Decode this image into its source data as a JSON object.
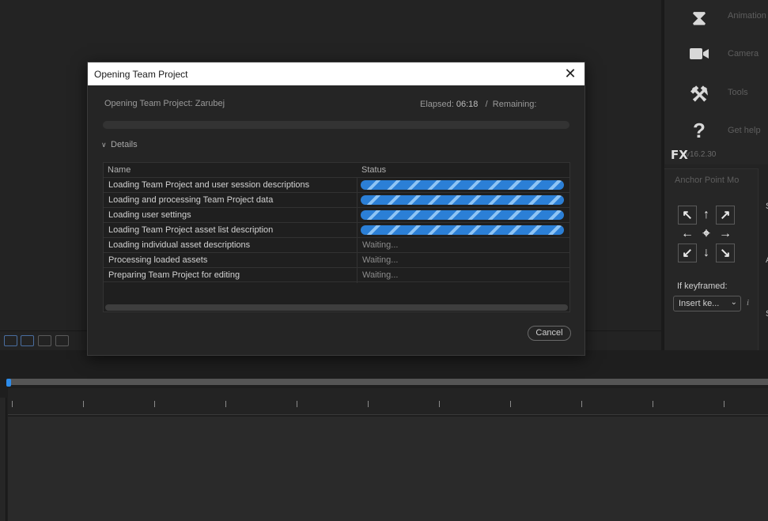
{
  "dialog": {
    "title": "Opening Team Project",
    "close_glyph": "✕",
    "subtitle": "Opening Team Project: Zarubej",
    "elapsed_label": "Elapsed:",
    "elapsed_value": "06:18",
    "separator": "/",
    "remaining_label": "Remaining:",
    "details_label": "Details",
    "columns": {
      "name": "Name",
      "status": "Status"
    },
    "tasks": [
      {
        "name": "Loading Team Project and user session descriptions",
        "status": "in-progress"
      },
      {
        "name": "Loading and processing Team Project data",
        "status": "in-progress"
      },
      {
        "name": "Loading user settings",
        "status": "in-progress"
      },
      {
        "name": "Loading Team Project asset list description",
        "status": "in-progress"
      },
      {
        "name": "Loading individual asset descriptions",
        "status": "Waiting..."
      },
      {
        "name": "Processing loaded assets",
        "status": "Waiting..."
      },
      {
        "name": "Preparing Team Project for editing",
        "status": "Waiting..."
      }
    ],
    "cancel_label": "Cancel",
    "accent_color": "#2b7fd6"
  },
  "right_panel": {
    "items": [
      {
        "icon": "hourglass-icon",
        "label": "Animation"
      },
      {
        "icon": "camera-icon",
        "label": "Camera"
      },
      {
        "icon": "tools-icon",
        "label": "Tools"
      },
      {
        "icon": "help-icon",
        "label": "Get help"
      }
    ],
    "logo": "FX",
    "version": "v16.2.30"
  },
  "anchor_panel": {
    "title": "Anchor Point Mo",
    "keyframed_label": "If keyframed:",
    "keyframed_value": "Insert ke...",
    "info_glyph": "i"
  },
  "far_right": {
    "labels": [
      "S",
      "A",
      "S"
    ]
  }
}
